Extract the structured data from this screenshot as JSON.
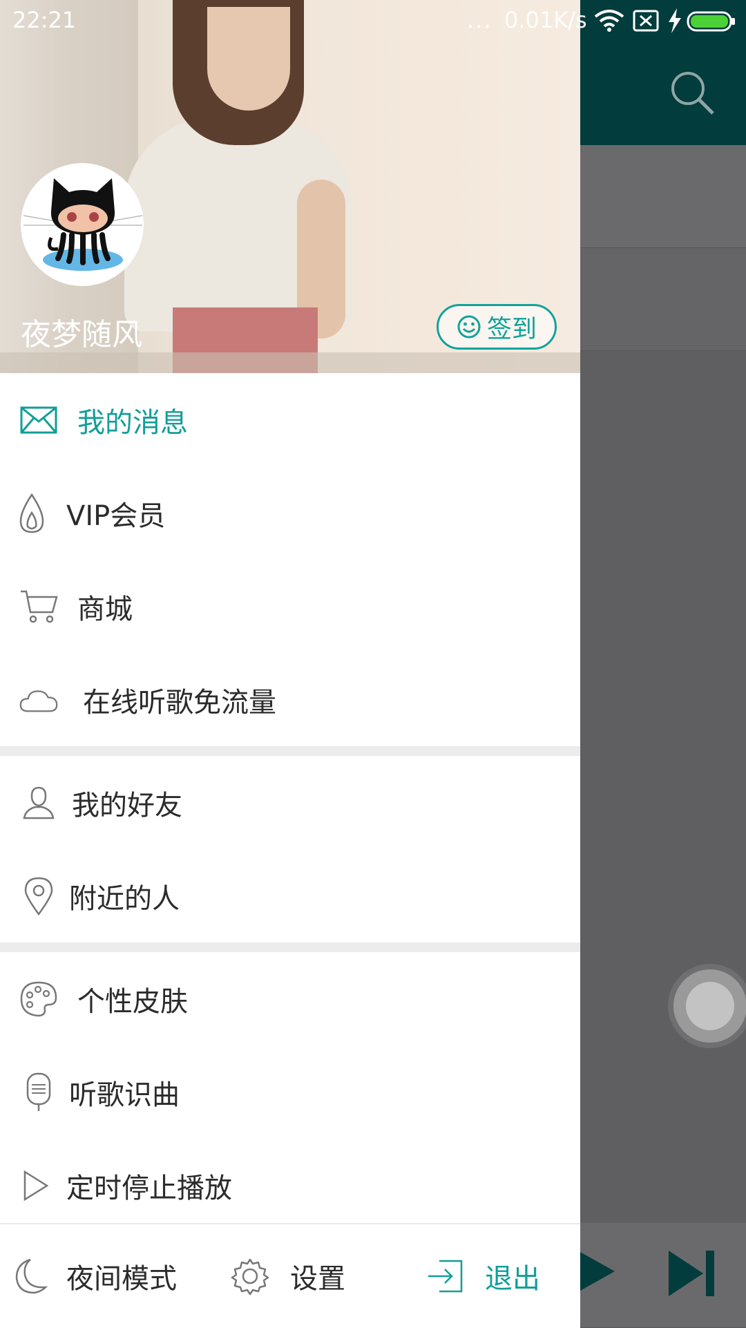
{
  "status_bar": {
    "time": "22:21",
    "dots": "...",
    "net_speed": "0.01K/s",
    "battery_color": "#4cd137"
  },
  "drawer": {
    "username": "夜梦随风",
    "signin_label": "签到",
    "accent_color": "#119e98",
    "menu_groups": [
      [
        {
          "icon": "envelope-icon",
          "label": "我的消息",
          "active": true
        },
        {
          "icon": "flame-icon",
          "label": "VIP会员"
        },
        {
          "icon": "cart-icon",
          "label": "商城"
        },
        {
          "icon": "cloud-icon",
          "label": "在线听歌免流量"
        }
      ],
      [
        {
          "icon": "person-icon",
          "label": "我的好友"
        },
        {
          "icon": "location-pin-icon",
          "label": "附近的人"
        }
      ],
      [
        {
          "icon": "palette-icon",
          "label": "个性皮肤"
        },
        {
          "icon": "microphone-icon",
          "label": "听歌识曲"
        },
        {
          "icon": "play-outline-icon",
          "label": "定时停止播放"
        }
      ]
    ],
    "bottom": {
      "night_mode": "夜间模式",
      "settings": "设置",
      "exit": "退出"
    }
  }
}
